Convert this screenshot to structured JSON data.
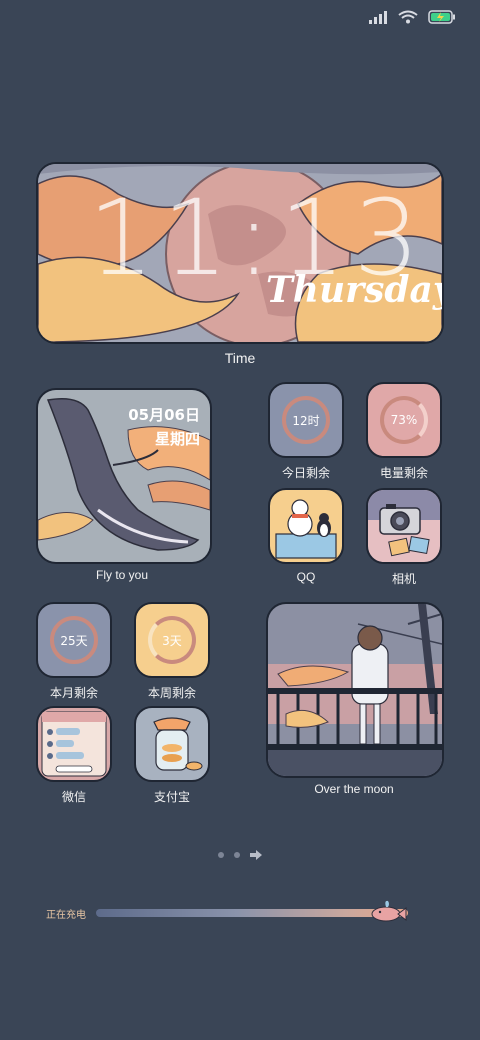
{
  "status_bar": {
    "icons": [
      "signal-icon",
      "wifi-icon",
      "battery-charging-icon"
    ]
  },
  "time_widget": {
    "time": "11:13",
    "day": "Thursday",
    "label": "Time"
  },
  "date_widget": {
    "date": "05月06日",
    "weekday": "星期四",
    "label": "Fly to you"
  },
  "apps_top_right": [
    {
      "value": "12时",
      "label": "今日剩余"
    },
    {
      "value": "73%",
      "label": "电量剩余"
    },
    {
      "value": "",
      "label": "QQ"
    },
    {
      "value": "",
      "label": "相机"
    }
  ],
  "apps_bottom_left": [
    {
      "value": "25天",
      "label": "本月剩余"
    },
    {
      "value": "3天",
      "label": "本周剩余"
    },
    {
      "value": "",
      "label": "微信"
    },
    {
      "value": "",
      "label": "支付宝"
    }
  ],
  "moon_widget": {
    "label": "Over the moon"
  },
  "charging": {
    "label": "正在充电"
  },
  "colors": {
    "background": "#3a4556",
    "tile_blue": "#8a93ab",
    "tile_pink": "#e0a8a8",
    "tile_yellow": "#f6cf8e",
    "ring": "#c98a7e"
  }
}
